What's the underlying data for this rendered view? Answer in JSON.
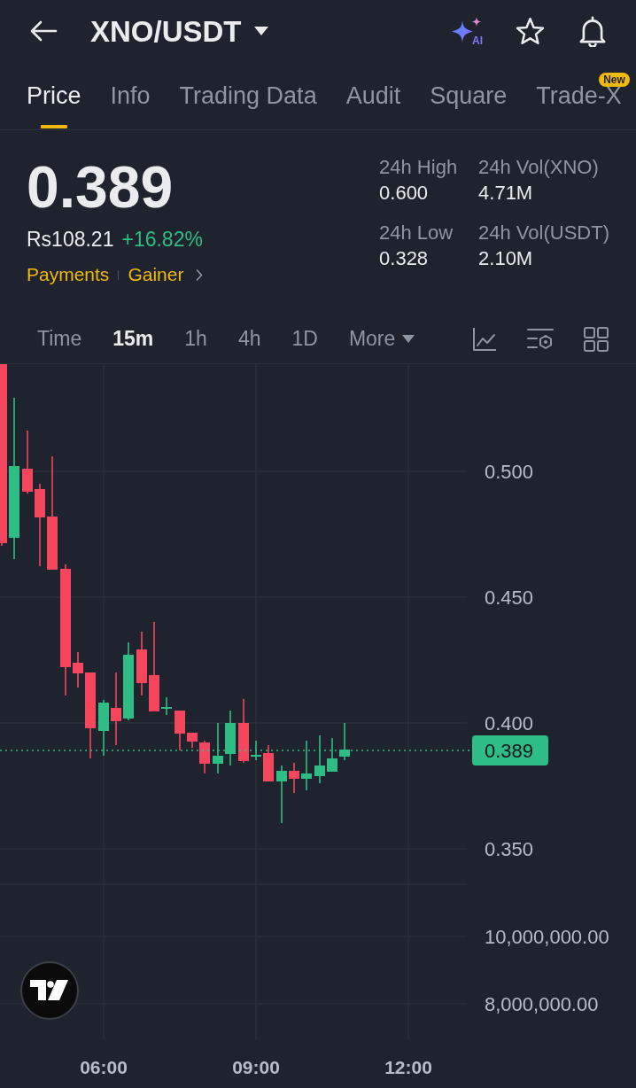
{
  "header": {
    "title": "XNO/USDT",
    "ai_label": "AI"
  },
  "tabs": [
    {
      "label": "Price",
      "selected": true
    },
    {
      "label": "Info",
      "selected": false
    },
    {
      "label": "Trading Data",
      "selected": false
    },
    {
      "label": "Audit",
      "selected": false
    },
    {
      "label": "Square",
      "selected": false
    },
    {
      "label": "Trade-X",
      "selected": false,
      "badge": "New"
    }
  ],
  "ticker": {
    "last_price": "0.389",
    "fiat_price": "Rs108.21",
    "change": "+16.82%",
    "tags": [
      "Payments",
      "Gainer"
    ]
  },
  "stats": [
    {
      "label": "24h High",
      "value": "0.600"
    },
    {
      "label": "24h Vol(XNO)",
      "value": "4.71M"
    },
    {
      "label": "24h Low",
      "value": "0.328"
    },
    {
      "label": "24h Vol(USDT)",
      "value": "2.10M"
    }
  ],
  "intervals": [
    {
      "label": "Time",
      "kind": "option",
      "selected": false
    },
    {
      "label": "15m",
      "kind": "option",
      "selected": true
    },
    {
      "label": "1h",
      "kind": "option",
      "selected": false
    },
    {
      "label": "4h",
      "kind": "option",
      "selected": false
    },
    {
      "label": "1D",
      "kind": "option",
      "selected": false
    },
    {
      "label": "More",
      "kind": "dropdown",
      "selected": false
    }
  ],
  "chart": {
    "price_ticks": [
      "0.500",
      "0.450",
      "0.400",
      "0.350"
    ],
    "last_price": "0.389",
    "volume_ticks": [
      "10,000,000.00",
      "8,000,000.00"
    ],
    "time_ticks": [
      "06:00",
      "09:00",
      "12:00"
    ]
  }
}
